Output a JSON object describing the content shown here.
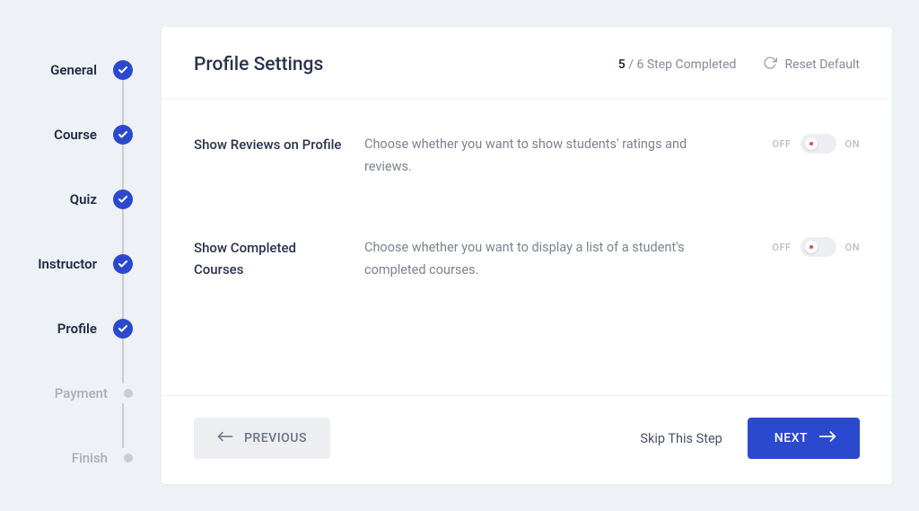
{
  "stepper": {
    "steps": [
      {
        "label": "General",
        "state": "done"
      },
      {
        "label": "Course",
        "state": "done"
      },
      {
        "label": "Quiz",
        "state": "done"
      },
      {
        "label": "Instructor",
        "state": "done"
      },
      {
        "label": "Profile",
        "state": "active"
      },
      {
        "label": "Payment",
        "state": "pending"
      },
      {
        "label": "Finish",
        "state": "pending"
      }
    ]
  },
  "header": {
    "title": "Profile Settings",
    "step_current": "5",
    "step_total_text": " / 6 Step Completed",
    "reset_label": "Reset Default"
  },
  "settings": [
    {
      "label": "Show Reviews on Profile",
      "description": "Choose whether you want to show students' ratings and reviews.",
      "off": "OFF",
      "on": "ON",
      "value": false
    },
    {
      "label": "Show Completed Courses",
      "description": "Choose whether you want to display a list of a student's completed courses.",
      "off": "OFF",
      "on": "ON",
      "value": false
    }
  ],
  "footer": {
    "previous": "Previous",
    "skip": "Skip This Step",
    "next": "Next"
  }
}
